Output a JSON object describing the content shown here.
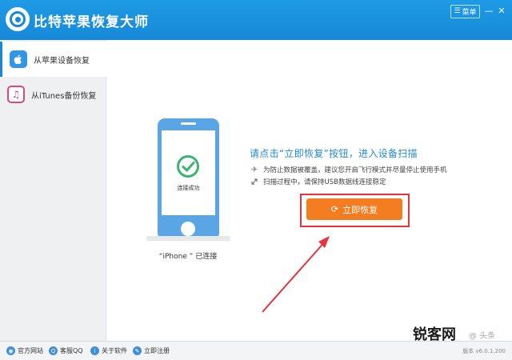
{
  "window": {
    "title": "比特苹果恢复大师",
    "menu_label": "菜单",
    "minimize": "—",
    "close": "✕"
  },
  "sidebar": {
    "items": [
      {
        "label": "从苹果设备恢复",
        "icon": "apple-icon",
        "active": true
      },
      {
        "label": "从iTunes备份恢复",
        "icon": "music-note-icon",
        "active": false
      }
    ]
  },
  "device": {
    "screen_status": "连接成功",
    "caption": "“iPhone ” 已连接"
  },
  "main": {
    "prompt": "请点击“立即恢复”按钮，进入设备扫描",
    "tips": [
      {
        "icon": "airplane-icon",
        "text": "为防止数据被覆盖，建议您开启飞行模式并尽量停止使用手机"
      },
      {
        "icon": "usb-icon",
        "text": "扫描过程中，请保持USB数据线连接稳定"
      }
    ],
    "recover_button": "立即恢复",
    "highlight_color": "#e8323e",
    "button_color": "#f47d21"
  },
  "statusbar": {
    "items": [
      {
        "label": "官方网站",
        "icon": "globe-icon"
      },
      {
        "label": "客服QQ",
        "icon": "qq-icon"
      },
      {
        "label": "关于软件",
        "icon": "info-icon"
      },
      {
        "label": "立即注册",
        "icon": "register-icon"
      }
    ],
    "version": "版本 v6.0.1.200"
  },
  "watermark": {
    "text": "锐客网",
    "sub": "@ 头条"
  },
  "colors": {
    "titlebar": "#1789d6",
    "accent": "#2389d6",
    "phone": "#59a5e6",
    "check": "#3cb371"
  }
}
